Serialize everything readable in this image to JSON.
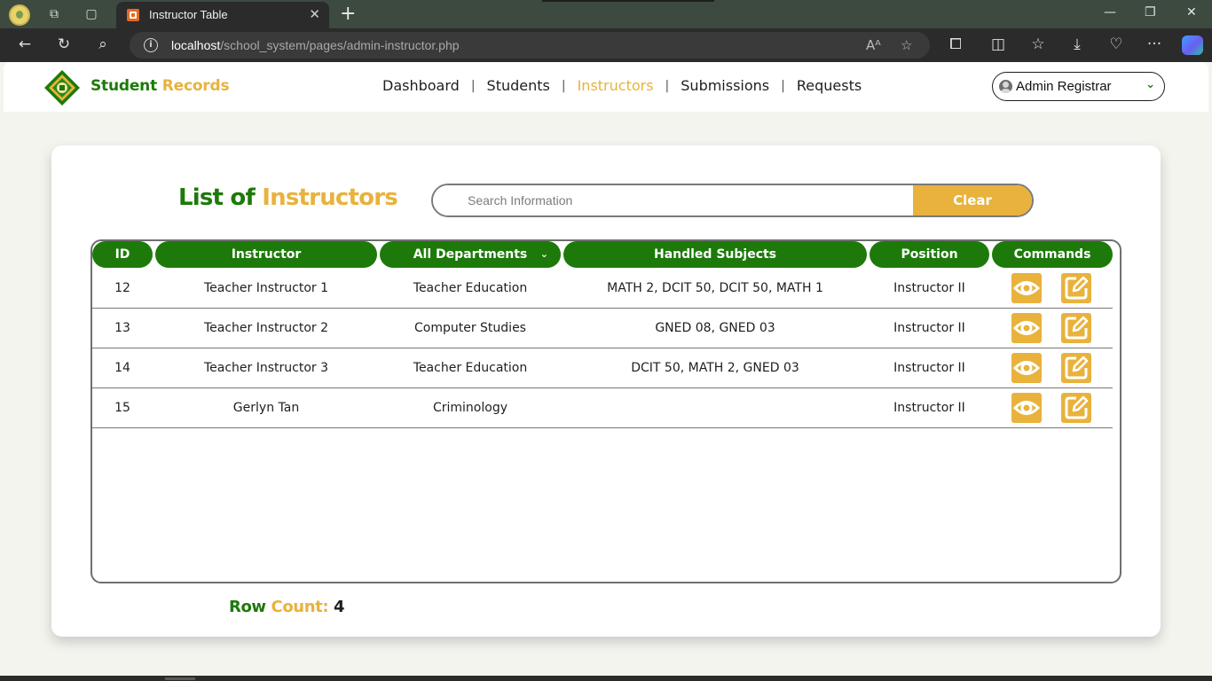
{
  "browser": {
    "tab_title": "Instructor Table",
    "url_host": "localhost",
    "url_path": "/school_system/pages/admin-instructor.php"
  },
  "header": {
    "brand_part1": "Student",
    "brand_part2": "Records",
    "nav": [
      "Dashboard",
      "Students",
      "Instructors",
      "Submissions",
      "Requests"
    ],
    "active_nav": "Instructors",
    "user": "Admin Registrar"
  },
  "main": {
    "title_part1": "List of",
    "title_part2": "Instructors",
    "search_placeholder": "Search Information",
    "clear_label": "Clear",
    "columns": {
      "id": "ID",
      "instructor": "Instructor",
      "department": "All Departments",
      "subjects": "Handled Subjects",
      "position": "Position",
      "commands": "Commands"
    },
    "rows": [
      {
        "id": "12",
        "instructor": "Teacher Instructor 1",
        "department": "Teacher Education",
        "subjects": "MATH 2, DCIT 50, DCIT 50, MATH 1",
        "position": "Instructor II"
      },
      {
        "id": "13",
        "instructor": "Teacher Instructor 2",
        "department": "Computer Studies",
        "subjects": "GNED 08, GNED 03",
        "position": "Instructor II"
      },
      {
        "id": "14",
        "instructor": "Teacher Instructor 3",
        "department": "Teacher Education",
        "subjects": "DCIT 50, MATH 2, GNED 03",
        "position": "Instructor II"
      },
      {
        "id": "15",
        "instructor": "Gerlyn Tan",
        "department": "Criminology",
        "subjects": "",
        "position": "Instructor II"
      }
    ],
    "row_count_label_1": "Row",
    "row_count_label_2": "Count:",
    "row_count_value": "4"
  },
  "colors": {
    "brand_green": "#1d7a0a",
    "brand_yellow": "#e8b23c"
  }
}
